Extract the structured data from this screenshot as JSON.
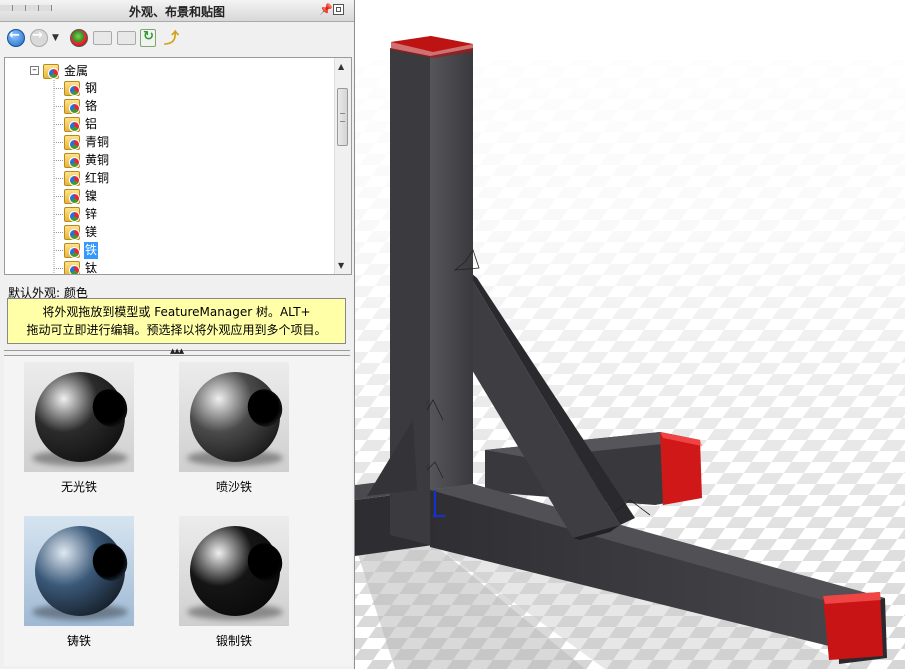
{
  "pane": {
    "title": "外观、布景和贴图",
    "tree": {
      "parent": "金属",
      "items": [
        "钢",
        "铬",
        "铝",
        "青铜",
        "黄铜",
        "红铜",
        "镍",
        "锌",
        "镁",
        "铁",
        "钛"
      ],
      "selected": "铁"
    },
    "default_appearance": "默认外观: 颜色",
    "tip": {
      "line1": "将外观拖放到模型或 FeatureManager 树。ALT+",
      "line2": "拖动可立即进行编辑。预选择以将外观应用到多个项目。"
    },
    "swatches": [
      {
        "label": "无光铁",
        "color": "#2b2b2b"
      },
      {
        "label": "喷沙铁",
        "color": "#4a4a4a"
      },
      {
        "label": "铸铁",
        "color": "#3a5878"
      },
      {
        "label": "锻制铁",
        "color": "#151515"
      }
    ]
  },
  "colors": {
    "selection": "#3399ff",
    "tip_background": "#ffffa8",
    "tube": "#3a3a3e",
    "tube_end_cap": "#d01818"
  },
  "icons": [
    "back-icon",
    "forward-icon",
    "history-dropdown-icon",
    "add-favorite-icon",
    "folder-icon",
    "new-folder-icon",
    "refresh-icon",
    "up-folder-icon",
    "pin-icon",
    "float-pane-icon"
  ]
}
